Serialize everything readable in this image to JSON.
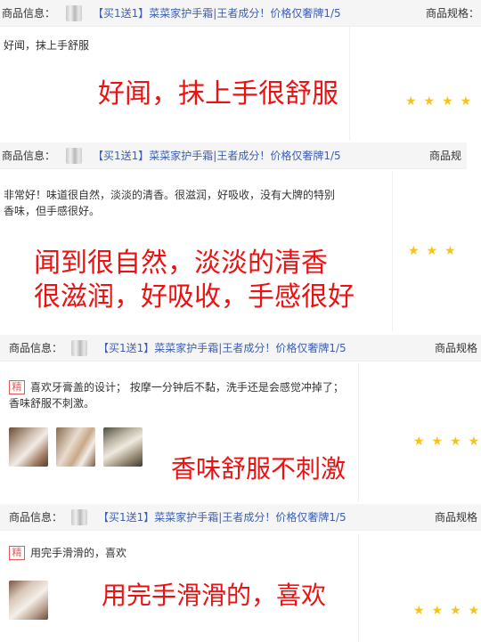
{
  "header": {
    "info_label": "商品信息：",
    "product_title": "【买1送1】菜菜家护手霜|王者成分！价格仅奢牌1/5",
    "spec_label": "商品规格：",
    "spec_label_short": "商品规",
    "spec_label_mid": "商品规格"
  },
  "reviews": [
    {
      "text": "好闻，抹上手舒服",
      "caption": "好闻，抹上手很舒服",
      "stars": "★★★★"
    },
    {
      "text": "非常好！味道很自然，淡淡的清香。很滋润，好吸收，没有大牌的特别香味，但手感很好。",
      "caption_line1": "闻到很自然，淡淡的清香",
      "caption_line2": "很滋润，好吸收，手感很好",
      "stars": "★★★"
    },
    {
      "badge": "精",
      "text": "喜欢牙膏盖的设计； 按摩一分钟后不黏，洗手还是会感觉冲掉了； 香味舒服不刺激。",
      "caption": "香味舒服不刺激",
      "stars": "★★★★"
    },
    {
      "badge": "精",
      "text": "用完手滑滑的，喜欢",
      "caption": "用完手滑滑的，喜欢",
      "stars": "★★★★"
    }
  ],
  "colors": {
    "caption_red": "#ee1111",
    "product_link_blue": "#3c5fb3",
    "star_yellow": "#f7c31b",
    "badge_red": "#e05a5a"
  },
  "icons": {
    "product_thumbnail": "hand-cream-thumbnail",
    "rating": "star-icon"
  }
}
